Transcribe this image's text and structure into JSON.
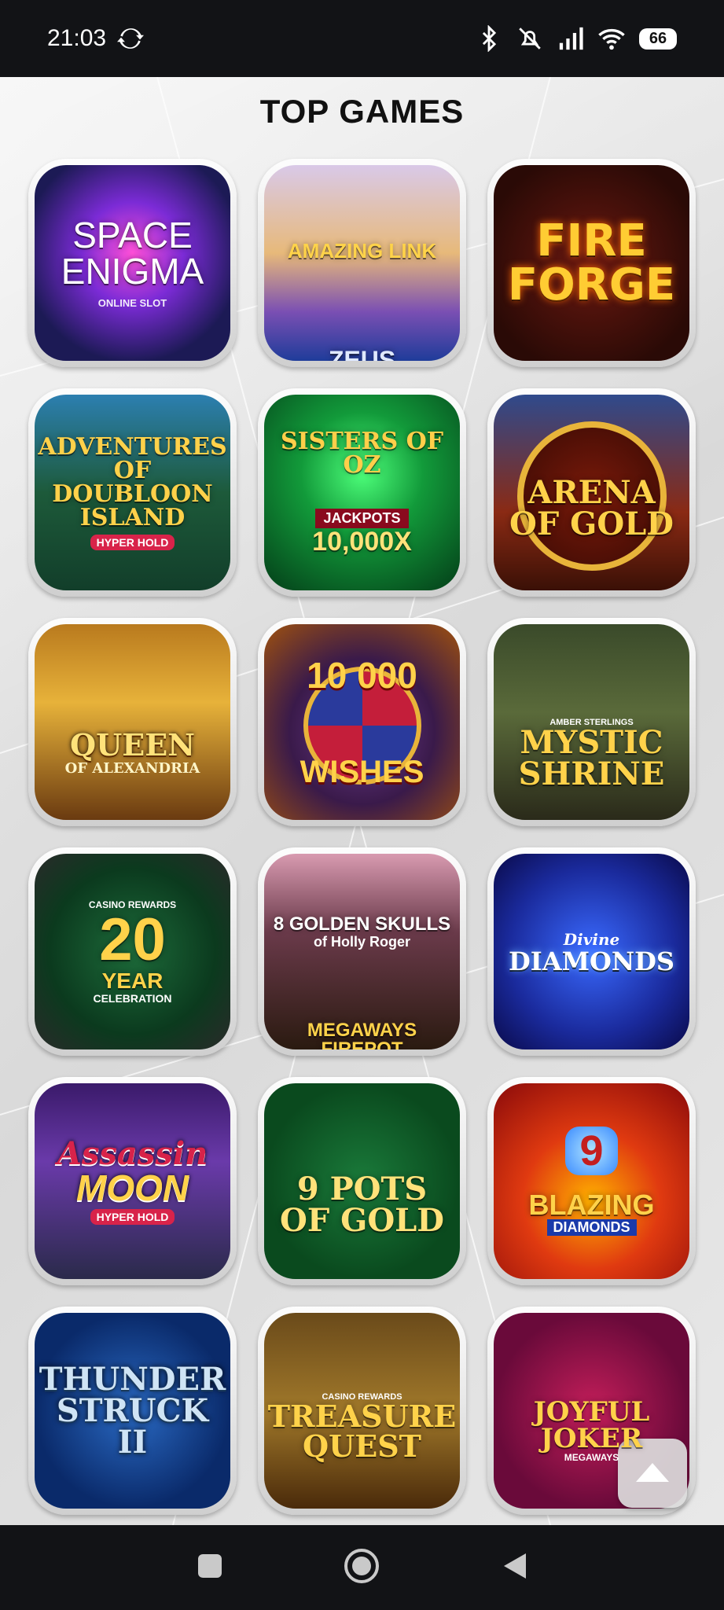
{
  "status": {
    "time": "21:03",
    "battery": "66"
  },
  "page": {
    "title": "TOP GAMES"
  },
  "games": [
    {
      "title": "SPACE ENIGMA",
      "subtitle": "ONLINE SLOT"
    },
    {
      "title": "AMAZING LINK",
      "subtitle": "ZEUS"
    },
    {
      "title": "FIRE FORGE"
    },
    {
      "title": "ADVENTURES OF DOUBLOON ISLAND",
      "subtitle": "HYPER HOLD"
    },
    {
      "title": "SISTERS OF OZ",
      "subtitle": "JACKPOTS",
      "extra": "10,000X"
    },
    {
      "title": "ARENA OF GOLD"
    },
    {
      "title": "QUEEN",
      "subtitle": "OF ALEXANDRIA"
    },
    {
      "title": "10 000",
      "subtitle": "WISHES"
    },
    {
      "title": "MYSTIC SHRINE",
      "subtitle": "AMBER STERLINGS"
    },
    {
      "title": "20",
      "subtitle": "CASINO REWARDS",
      "extra": "YEAR",
      "extra2": "CELEBRATION"
    },
    {
      "title": "8 GOLDEN SKULLS",
      "subtitle": "of Holly Roger",
      "extra": "MEGAWAYS FIREPOT"
    },
    {
      "title": "DIAMONDS",
      "subtitle": "Divine"
    },
    {
      "title": "Assassin",
      "subtitle": "HYPER HOLD",
      "extra": "MOON"
    },
    {
      "title": "9 POTS OF GOLD"
    },
    {
      "title": "BLAZING",
      "subtitle": "DIAMONDS",
      "extra": "9"
    },
    {
      "title": "THUNDER STRUCK II"
    },
    {
      "title": "TREASURE QUEST",
      "subtitle": "CASINO REWARDS"
    },
    {
      "title": "JOYFUL JOKER",
      "subtitle": "MEGAWAYS"
    }
  ],
  "icons": {
    "sync": "sync-icon",
    "bluetooth": "bluetooth-icon",
    "mute": "bell-muted-icon",
    "signal": "signal-icon",
    "wifi": "wifi-icon",
    "scroll_top": "chevron-up-icon",
    "nav_recent": "square-icon",
    "nav_home": "circle-icon",
    "nav_back": "triangle-back-icon"
  }
}
